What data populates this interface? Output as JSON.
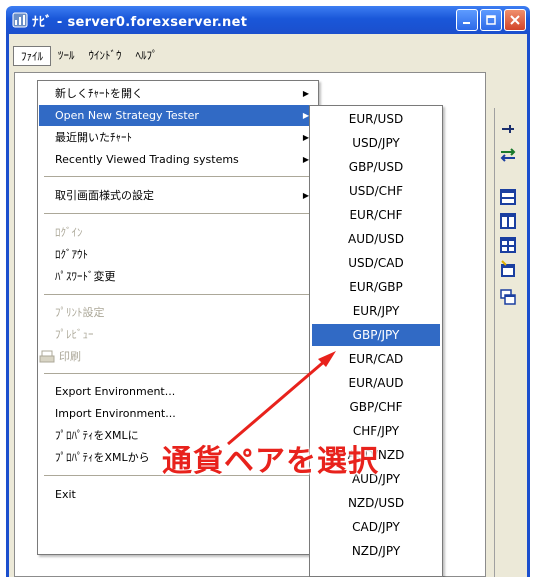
{
  "window": {
    "title": "ﾅﾋﾞ - server0.forexserver.net"
  },
  "menubar": {
    "items": [
      "ﾌｧｲﾙ",
      "ﾂｰﾙ",
      "ｳｲﾝﾄﾞｳ",
      "ﾍﾙﾌﾟ"
    ]
  },
  "file_menu": {
    "items": [
      {
        "label": "新しくﾁｬｰﾄを開く",
        "submenu": true
      },
      {
        "label": "Open New Strategy Tester",
        "submenu": true,
        "highlighted": true
      },
      {
        "label": "最近開いたﾁｬｰﾄ",
        "submenu": true
      },
      {
        "label": "Recently Viewed Trading systems",
        "submenu": true
      },
      {
        "label": "取引画面様式の設定",
        "submenu": true
      },
      {
        "label": "ﾛｸﾞｲﾝ",
        "disabled": true
      },
      {
        "label": "ﾛｸﾞｱｳﾄ"
      },
      {
        "label": "ﾊﾟｽﾜｰﾄﾞ変更"
      },
      {
        "label": "ﾌﾟﾘﾝﾄ設定",
        "disabled": true
      },
      {
        "label": "ﾌﾟﾚﾋﾞｭｰ",
        "disabled": true
      },
      {
        "label": "印刷",
        "disabled": true
      },
      {
        "label": "Export Environment..."
      },
      {
        "label": "Import Environment..."
      },
      {
        "label": "ﾌﾟﾛﾊﾟﾃｨをXMLに"
      },
      {
        "label": "ﾌﾟﾛﾊﾟﾃｨをXMLから"
      },
      {
        "label": "Exit"
      }
    ]
  },
  "currency_submenu": {
    "items": [
      "EUR/USD",
      "USD/JPY",
      "GBP/USD",
      "USD/CHF",
      "EUR/CHF",
      "AUD/USD",
      "USD/CAD",
      "EUR/GBP",
      "EUR/JPY",
      "GBP/JPY",
      "EUR/CAD",
      "EUR/AUD",
      "GBP/CHF",
      "CHF/JPY",
      "AUD/NZD",
      "AUD/JPY",
      "NZD/USD",
      "CAD/JPY",
      "NZD/JPY"
    ],
    "selected": "GBP/JPY"
  },
  "annotation": {
    "text": "通貨ペアを選択",
    "color": "#e8221c"
  },
  "colors": {
    "titlebar": "#1b4fcd",
    "highlight": "#316ac5",
    "disabled_text": "#aca899"
  }
}
